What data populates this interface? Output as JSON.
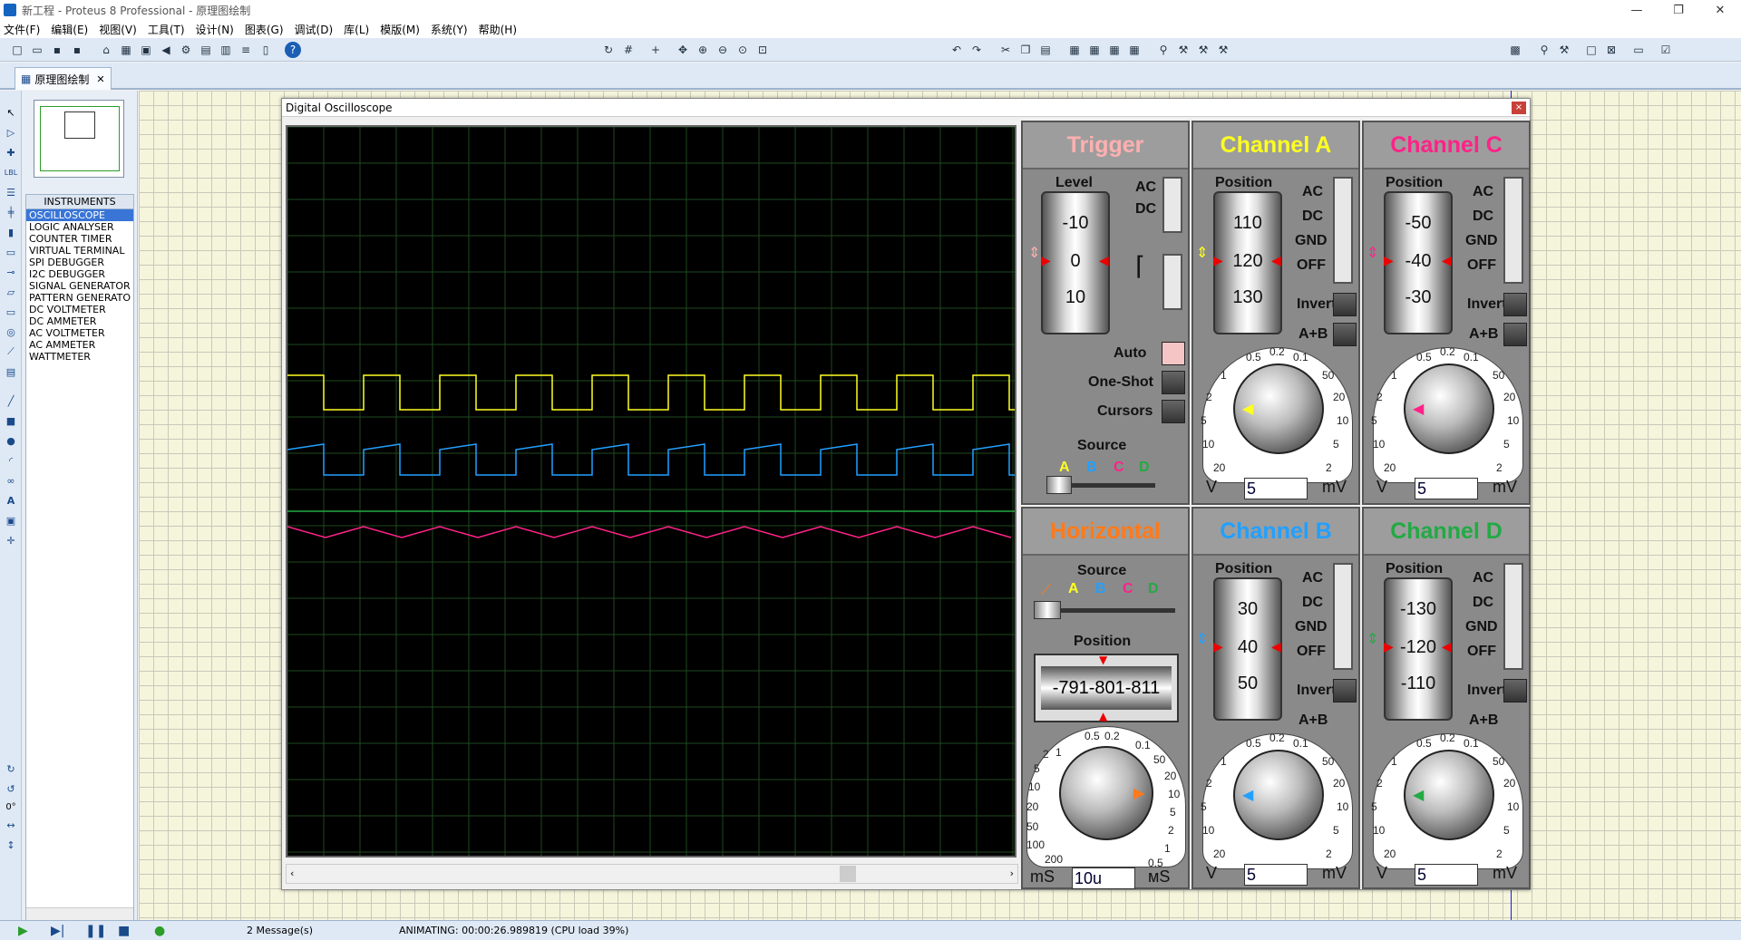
{
  "window": {
    "title": "新工程 - Proteus 8 Professional - 原理图绘制",
    "min": "—",
    "max": "❐",
    "close": "✕"
  },
  "menu": [
    "文件(F)",
    "编辑(E)",
    "视图(V)",
    "工具(T)",
    "设计(N)",
    "图表(G)",
    "调试(D)",
    "库(L)",
    "模版(M)",
    "系统(Y)",
    "帮助(H)"
  ],
  "tab": {
    "label": "原理图绘制",
    "close": "✕"
  },
  "instruments": {
    "header": "INSTRUMENTS",
    "items": [
      "OSCILLOSCOPE",
      "LOGIC ANALYSER",
      "COUNTER TIMER",
      "VIRTUAL TERMINAL",
      "SPI DEBUGGER",
      "I2C DEBUGGER",
      "SIGNAL GENERATOR",
      "PATTERN GENERATO",
      "DC VOLTMETER",
      "DC AMMETER",
      "AC VOLTMETER",
      "AC AMMETER",
      "WATTMETER"
    ],
    "selected": 0
  },
  "rotation": "0°",
  "status": {
    "messages": "2 Message(s)",
    "animating": "ANIMATING: 00:00:26.989819 (CPU load 39%)"
  },
  "osc": {
    "title": "Digital Oscilloscope",
    "close": "×",
    "trigger": {
      "title": "Trigger",
      "level": "Level",
      "ac": "AC",
      "dc": "DC",
      "drum": [
        "-10",
        "0",
        "10"
      ],
      "auto": "Auto",
      "oneshot": "One-Shot",
      "cursors": "Cursors",
      "source": "Source",
      "src": [
        "A",
        "B",
        "C",
        "D"
      ]
    },
    "channel_a": {
      "title": "Channel A",
      "position": "Position",
      "drum": [
        "110",
        "120",
        "130"
      ],
      "ac": "AC",
      "dc": "DC",
      "gnd": "GND",
      "off": "OFF",
      "invert": "Invert",
      "apb": "A+B",
      "value": "5",
      "v": "V",
      "mv": "mV"
    },
    "channel_c": {
      "title": "Channel C",
      "position": "Position",
      "drum": [
        "-50",
        "-40",
        "-30"
      ],
      "ac": "AC",
      "dc": "DC",
      "gnd": "GND",
      "off": "OFF",
      "invert": "Invert",
      "apb": "A+B",
      "value": "5",
      "v": "V",
      "mv": "mV"
    },
    "horizontal": {
      "title": "Horizontal",
      "source": "Source",
      "src": [
        "A",
        "B",
        "C",
        "D"
      ],
      "position": "Position",
      "readout": "-791-801-811",
      "value": "10u",
      "ms": "mS",
      "us": "мS"
    },
    "channel_b": {
      "title": "Channel B",
      "position": "Position",
      "drum": [
        "30",
        "40",
        "50"
      ],
      "ac": "AC",
      "dc": "DC",
      "gnd": "GND",
      "off": "OFF",
      "invert": "Invert",
      "apb": "A+B",
      "value": "5",
      "v": "V",
      "mv": "mV"
    },
    "channel_d": {
      "title": "Channel D",
      "position": "Position",
      "drum": [
        "-130",
        "-120",
        "-110"
      ],
      "ac": "AC",
      "dc": "DC",
      "gnd": "GND",
      "off": "OFF",
      "invert": "Invert",
      "apb": "A+B",
      "value": "5",
      "v": "V",
      "mv": "mV"
    },
    "volt_ticks": [
      "0.5",
      "0.2",
      "0.1",
      "50",
      "20",
      "10",
      "5",
      "2",
      "20",
      "10",
      "5",
      "2",
      "1"
    ],
    "time_ticks": [
      "1",
      "0.5",
      "0.2",
      "0.1",
      "50",
      "20",
      "10",
      "5",
      "2",
      "1",
      "0.5",
      "200",
      "100",
      "50",
      "20",
      "10",
      "5",
      "2"
    ],
    "colors": {
      "a": "#ffff22",
      "b": "#22a0ff",
      "c": "#ff2288",
      "d": "#22aa44",
      "h": "#ff7a1a",
      "t": "#ffb0b0"
    }
  }
}
